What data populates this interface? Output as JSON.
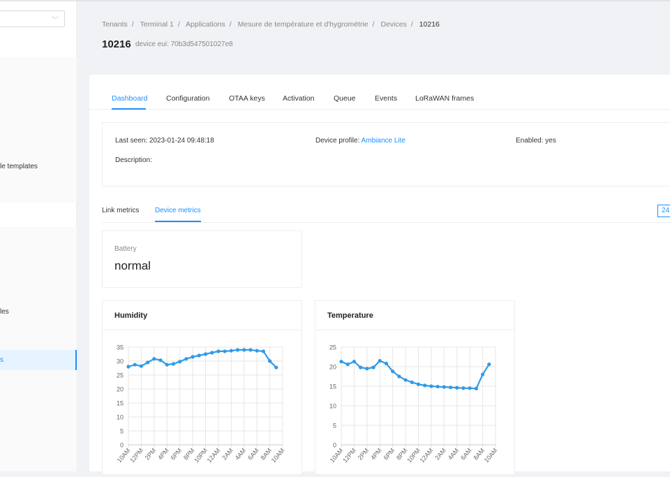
{
  "sidebar": {
    "select_value": "",
    "items": [
      {
        "label": "le templates"
      },
      {
        "label": "les"
      },
      {
        "label": "s"
      }
    ]
  },
  "breadcrumb": [
    "Tenants",
    "Terminal 1",
    "Applications",
    "Mesure de température et d'hygrométrie",
    "Devices",
    "10216"
  ],
  "device": {
    "name": "10216",
    "eui": "device eui: 70b3d547501027e8"
  },
  "tabs": [
    "Dashboard",
    "Configuration",
    "OTAA keys",
    "Activation",
    "Queue",
    "Events",
    "LoRaWAN frames"
  ],
  "info": {
    "last_seen_label": "Last seen:",
    "last_seen": "2023-01-24 09:48:18",
    "profile_label": "Device profile:",
    "profile": "Ambiance Lite",
    "enabled_label": "Enabled:",
    "enabled": "yes",
    "description_label": "Description:"
  },
  "subtabs": [
    "Link metrics",
    "Device metrics"
  ],
  "range_label": "24",
  "battery": {
    "label": "Battery",
    "value": "normal"
  },
  "colors": {
    "accent": "#1890ff",
    "series": "#2f9ae8"
  },
  "chart_data": [
    {
      "type": "line",
      "title": "Humidity",
      "ylim": [
        0,
        35
      ],
      "yticks": [
        0,
        5,
        10,
        15,
        20,
        25,
        30,
        35
      ],
      "xticks": [
        "10AM",
        "12PM",
        "2PM",
        "4PM",
        "6PM",
        "8PM",
        "10PM",
        "12AM",
        "2AM",
        "4AM",
        "6AM",
        "8AM",
        "10AM"
      ],
      "x": [
        "10AM",
        "11AM",
        "12PM",
        "1PM",
        "2PM",
        "3PM",
        "4PM",
        "5PM",
        "6PM",
        "7PM",
        "8PM",
        "9PM",
        "10PM",
        "11PM",
        "12AM",
        "1AM",
        "2AM",
        "3AM",
        "4AM",
        "5AM",
        "6AM",
        "7AM",
        "8AM",
        "9AM"
      ],
      "values": [
        28,
        28.7,
        28.2,
        29.5,
        30.8,
        30.3,
        28.7,
        29,
        29.8,
        30.8,
        31.5,
        32,
        32.5,
        33,
        33.5,
        33.5,
        33.7,
        34,
        34,
        34,
        33.7,
        33.5,
        30,
        27.7
      ]
    },
    {
      "type": "line",
      "title": "Temperature",
      "ylim": [
        0,
        25
      ],
      "yticks": [
        0,
        5,
        10,
        15,
        20,
        25
      ],
      "xticks": [
        "10AM",
        "12PM",
        "2PM",
        "4PM",
        "6PM",
        "8PM",
        "10PM",
        "12AM",
        "2AM",
        "4AM",
        "6AM",
        "8AM",
        "10AM"
      ],
      "x": [
        "10AM",
        "11AM",
        "12PM",
        "1PM",
        "2PM",
        "3PM",
        "4PM",
        "5PM",
        "6PM",
        "7PM",
        "8PM",
        "9PM",
        "10PM",
        "11PM",
        "12AM",
        "1AM",
        "2AM",
        "3AM",
        "4AM",
        "5AM",
        "6AM",
        "7AM",
        "8AM",
        "9AM"
      ],
      "values": [
        21.3,
        20.6,
        21.3,
        19.8,
        19.5,
        19.8,
        21.5,
        20.8,
        18.8,
        17.5,
        16.6,
        16,
        15.5,
        15.2,
        15,
        14.9,
        14.8,
        14.7,
        14.6,
        14.5,
        14.5,
        14.4,
        18,
        20.6
      ]
    }
  ]
}
